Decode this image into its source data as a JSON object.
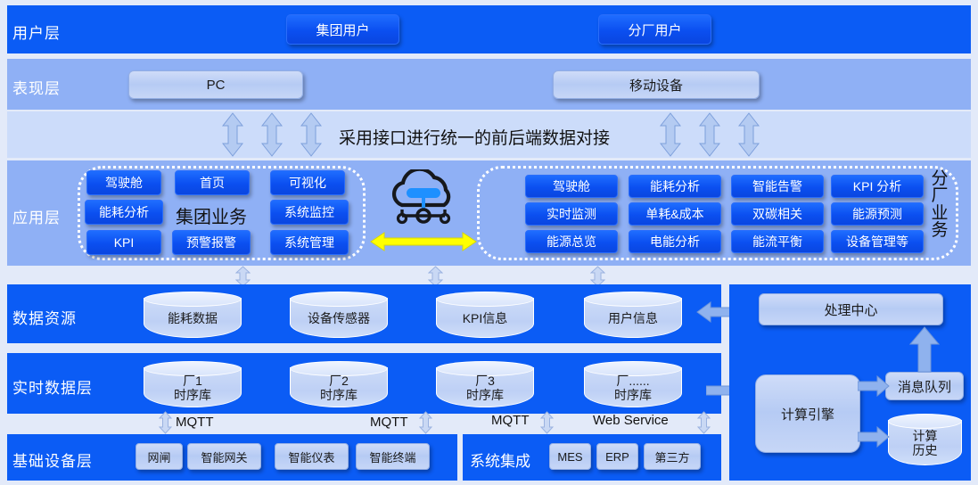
{
  "layers": {
    "user": {
      "label": "用户层"
    },
    "present": {
      "label": "表现层"
    },
    "app": {
      "label": "应用层"
    },
    "data_res": {
      "label": "数据资源"
    },
    "realtime": {
      "label": "实时数据层"
    },
    "infra": {
      "label": "基础设备层"
    }
  },
  "user_layer": {
    "buttons": [
      {
        "label": "集团用户"
      },
      {
        "label": "分厂用户"
      }
    ]
  },
  "presentation_layer": {
    "buttons": [
      {
        "label": "PC"
      },
      {
        "label": "移动设备"
      }
    ]
  },
  "interface_band": {
    "text": "采用接口进行统一的前后端数据对接",
    "arrow_icon": "double-headed-vertical-arrow-icon",
    "arrow_count_left": 3,
    "arrow_count_right": 3
  },
  "app_layer": {
    "group_left": {
      "title": "集团业务",
      "items": [
        "驾驶舱",
        "首页",
        "可视化",
        "能耗分析",
        "系统监控",
        "KPI",
        "预警报警",
        "系统管理"
      ]
    },
    "center": {
      "cloud_icon": "cloud-network-icon",
      "exchange_arrow_icon": "double-headed-horizontal-arrow-icon",
      "arrow_color": "#ffff00"
    },
    "group_right": {
      "title": "分厂业务",
      "rows": [
        [
          "驾驶舱",
          "能耗分析",
          "智能告警",
          "KPI 分析"
        ],
        [
          "实时监测",
          "单耗&成本",
          "双碳相关",
          "能源预测"
        ],
        [
          "能源总览",
          "电能分析",
          "能流平衡",
          "设备管理等"
        ]
      ]
    }
  },
  "data_resource_layer": {
    "stores": [
      {
        "label": "能耗数据"
      },
      {
        "label": "设备传感器"
      },
      {
        "label": "KPI信息"
      },
      {
        "label": "用户信息"
      }
    ]
  },
  "realtime_layer": {
    "stores": [
      {
        "line1": "厂1",
        "line2": "时序库"
      },
      {
        "line1": "厂2",
        "line2": "时序库"
      },
      {
        "line1": "厂3",
        "line2": "时序库"
      },
      {
        "line1": "厂......",
        "line2": "时序库"
      }
    ]
  },
  "protocol_labels": [
    {
      "label": "MQTT"
    },
    {
      "label": "MQTT"
    },
    {
      "label": "MQTT"
    },
    {
      "label": "Web Service"
    }
  ],
  "infra_layer": {
    "devices": [
      "网闸",
      "智能网关",
      "智能仪表",
      "智能终端"
    ],
    "integration": {
      "title": "系统集成",
      "systems": [
        "MES",
        "ERP",
        "第三方"
      ]
    }
  },
  "processing_panel": {
    "center": {
      "label": "处理中心"
    },
    "engine": {
      "label": "计算引擎"
    },
    "queue": {
      "label": "消息队列"
    },
    "history": {
      "line1": "计算",
      "line2": "历史"
    }
  },
  "colors": {
    "bright_blue": "#0b5cf5",
    "soft_blue": "#8fb0f5",
    "pale_blue": "#ccdcfa",
    "page_bg": "#e3eaf9",
    "accent_yellow": "#ffff00",
    "arrow_blue": "#8fb2ee"
  }
}
